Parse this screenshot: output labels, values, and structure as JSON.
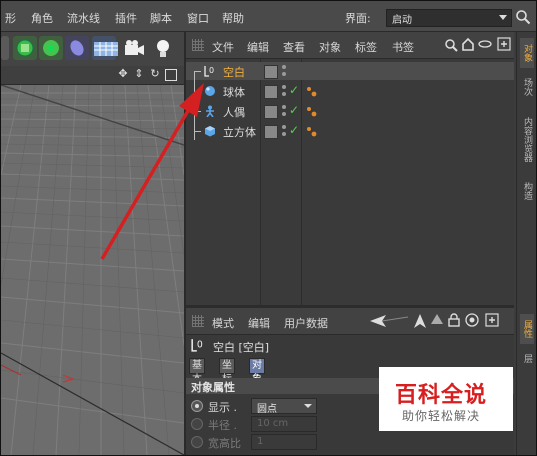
{
  "menubar": {
    "items": [
      "形",
      "角色",
      "流水线",
      "插件",
      "脚本",
      "窗口",
      "帮助"
    ],
    "layout_label": "界面:",
    "layout_value": "启动"
  },
  "object_manager": {
    "menu": [
      "文件",
      "编辑",
      "查看",
      "对象",
      "标签",
      "书签"
    ],
    "objects": [
      {
        "label": "空白",
        "icon": "null-object-icon",
        "selected": true
      },
      {
        "label": "球体",
        "icon": "sphere-icon",
        "selected": false
      },
      {
        "label": "人偶",
        "icon": "figure-icon",
        "selected": false
      },
      {
        "label": "立方体",
        "icon": "cube-icon",
        "selected": false
      }
    ]
  },
  "side_tabs": {
    "upper": [
      "对象",
      "场次",
      "内容浏览器",
      "构造"
    ],
    "lower": [
      "属性",
      "层"
    ]
  },
  "attribute_manager": {
    "menu": [
      "模式",
      "编辑",
      "用户数据"
    ],
    "title": "空白 [空白]",
    "tabs": [
      "基本",
      "坐标",
      "对象"
    ],
    "active_tab": "对象",
    "section": "对象属性",
    "props": [
      {
        "label": "显示 .",
        "value": "圆点",
        "enabled": true
      },
      {
        "label": "半径 .",
        "value": "10 cm",
        "enabled": false
      },
      {
        "label": "宽高比",
        "value": "1",
        "enabled": false
      }
    ]
  },
  "watermark": {
    "title": "百科全说",
    "subtitle": "助你轻松解决"
  },
  "colors": {
    "arrow": "#d42020",
    "selected_label": "#f0b040",
    "check": "#54d34a"
  }
}
